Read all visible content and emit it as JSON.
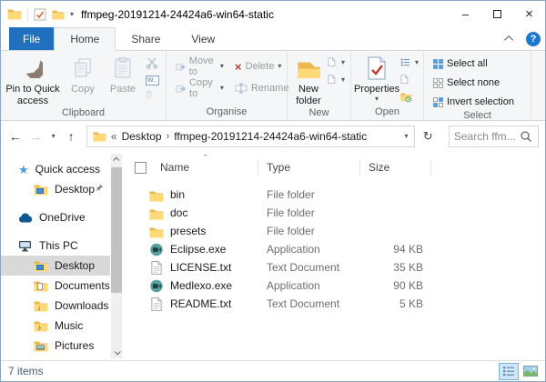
{
  "window": {
    "title": "ffmpeg-20191214-24424a6-win64-static"
  },
  "icons": {
    "minimize": "–",
    "close": "×",
    "back": "←",
    "forward": "→",
    "up": "↑",
    "refresh": "↻",
    "dropdown": "▾",
    "crumb_ellipsis": "«",
    "crumb_separator": "›",
    "sort_asc": "ˆ",
    "help": "?",
    "star": "★",
    "music_note": "♪",
    "download_arrow": "↓",
    "delete_x": "×",
    "copy_path_label": "W.."
  },
  "tabs": {
    "file": "File",
    "items": [
      {
        "label": "Home"
      },
      {
        "label": "Share"
      },
      {
        "label": "View"
      }
    ],
    "selected": "Home"
  },
  "ribbon": {
    "clipboard": {
      "label": "Clipboard",
      "pin": "Pin to Quick access",
      "copy": "Copy",
      "paste": "Paste"
    },
    "organise": {
      "label": "Organise",
      "move_to": "Move to",
      "copy_to": "Copy to",
      "delete": "Delete",
      "rename": "Rename"
    },
    "new": {
      "label": "New",
      "new_folder": "New folder"
    },
    "open": {
      "label": "Open",
      "properties": "Properties"
    },
    "select": {
      "label": "Select",
      "select_all": "Select all",
      "select_none": "Select none",
      "invert": "Invert selection"
    }
  },
  "addressbar": {
    "crumb_parent": "Desktop",
    "crumb_current": "ffmpeg-20191214-24424a6-win64-static",
    "search_placeholder": "Search ffm..."
  },
  "sidebar": {
    "quick_access": "Quick access",
    "qa_desktop": "Desktop",
    "onedrive": "OneDrive",
    "this_pc": "This PC",
    "items": [
      {
        "label": "Desktop",
        "selected": true
      },
      {
        "label": "Documents"
      },
      {
        "label": "Downloads"
      },
      {
        "label": "Music"
      },
      {
        "label": "Pictures"
      }
    ]
  },
  "filelist": {
    "columns": {
      "name": "Name",
      "type": "Type",
      "size": "Size"
    },
    "rows": [
      {
        "name": "bin",
        "type": "File folder",
        "size": "",
        "icon": "folder"
      },
      {
        "name": "doc",
        "type": "File folder",
        "size": "",
        "icon": "folder"
      },
      {
        "name": "presets",
        "type": "File folder",
        "size": "",
        "icon": "folder"
      },
      {
        "name": "Eclipse.exe",
        "type": "Application",
        "size": "94 KB",
        "icon": "exe"
      },
      {
        "name": "LICENSE.txt",
        "type": "Text Document",
        "size": "35 KB",
        "icon": "txt"
      },
      {
        "name": "Medlexo.exe",
        "type": "Application",
        "size": "90 KB",
        "icon": "exe"
      },
      {
        "name": "README.txt",
        "type": "Text Document",
        "size": "5 KB",
        "icon": "txt"
      }
    ]
  },
  "statusbar": {
    "count": "7 items"
  },
  "colors": {
    "file_tab_blue": "#2170bf",
    "help_blue": "#1d78d2",
    "folder_yellow": "#ffd977",
    "folder_edge": "#eab84f",
    "selection_gray": "#d9d9d9",
    "exe_teal": "#57a0a0",
    "status_text": "#4a5b77",
    "view_selected_bg": "#cfe5fa"
  }
}
